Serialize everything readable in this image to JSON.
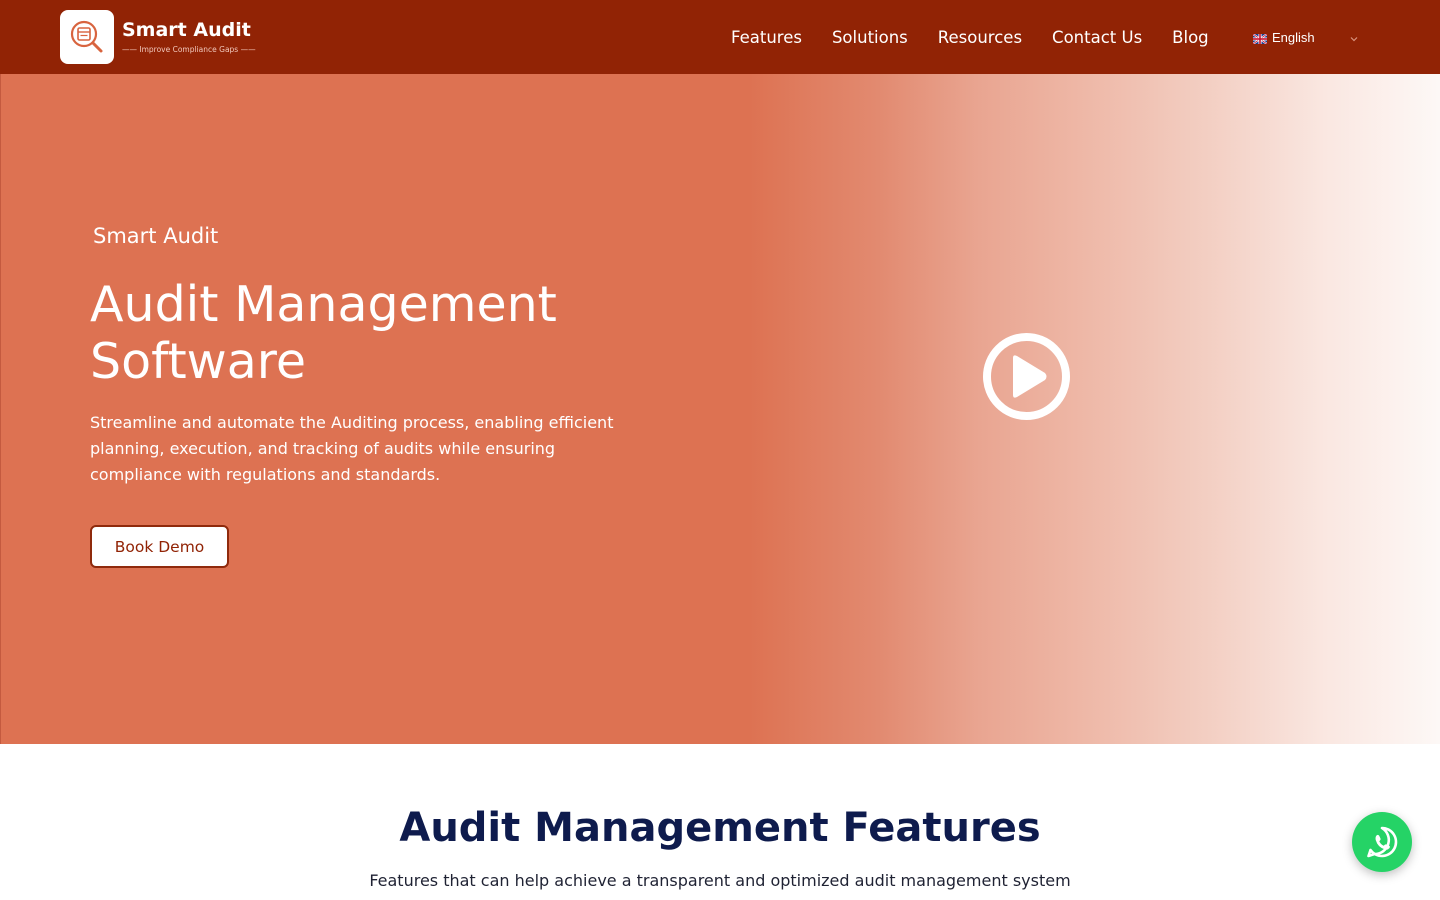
{
  "header": {
    "logo": {
      "name": "Smart Audit",
      "tagline": "—— Improve Compliance Gaps ——",
      "icon": "magnifier-document-icon"
    },
    "nav": [
      {
        "label": "Features"
      },
      {
        "label": "Solutions"
      },
      {
        "label": "Resources"
      },
      {
        "label": "Contact Us"
      },
      {
        "label": "Blog"
      }
    ],
    "language": {
      "selected": "English",
      "flag_icon": "uk-flag-icon",
      "chevron_icon": "chevron-down-icon"
    }
  },
  "hero": {
    "eyebrow": "Smart Audit",
    "title": "Audit Management Software",
    "description": "Streamline and automate the Auditing process, enabling efficient planning, execution, and tracking of audits while ensuring compliance with regulations and standards.",
    "cta_label": "Book Demo",
    "play_icon": "play-circle-icon"
  },
  "features": {
    "title": "Audit Management Features",
    "subtitle": "Features that can help achieve a transparent and optimized audit management system"
  },
  "whatsapp": {
    "icon": "whatsapp-icon"
  },
  "colors": {
    "header_bg": "#912305",
    "hero_bg": "#dd7252",
    "heading_navy": "#0e1b4d",
    "whatsapp_green": "#25d366"
  }
}
